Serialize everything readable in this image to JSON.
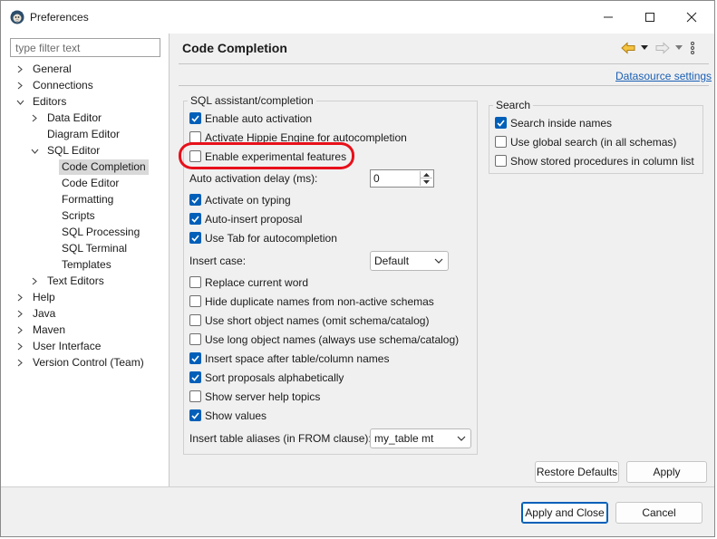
{
  "window": {
    "title": "Preferences"
  },
  "filter": {
    "placeholder": "type filter text",
    "value": ""
  },
  "tree": [
    {
      "label": "General",
      "expanded": false
    },
    {
      "label": "Connections",
      "expanded": false
    },
    {
      "label": "Editors",
      "expanded": true
    },
    {
      "label": "Data Editor",
      "expanded": false
    },
    {
      "label": "Diagram Editor"
    },
    {
      "label": "SQL Editor",
      "expanded": true
    },
    {
      "label": "Code Completion",
      "selected": true
    },
    {
      "label": "Code Editor"
    },
    {
      "label": "Formatting"
    },
    {
      "label": "Scripts"
    },
    {
      "label": "SQL Processing"
    },
    {
      "label": "SQL Terminal"
    },
    {
      "label": "Templates"
    },
    {
      "label": "Text Editors",
      "expanded": false
    },
    {
      "label": "Help",
      "expanded": false
    },
    {
      "label": "Java",
      "expanded": false
    },
    {
      "label": "Maven",
      "expanded": false
    },
    {
      "label": "User Interface",
      "expanded": false
    },
    {
      "label": "Version Control (Team)",
      "expanded": false
    }
  ],
  "page": {
    "title": "Code Completion",
    "datasource_link": "Datasource settings"
  },
  "sql_group": {
    "legend": "SQL assistant/completion",
    "enable_auto_activation": {
      "label": "Enable auto activation",
      "checked": true
    },
    "hippie_engine": {
      "label": "Activate Hippie Engine for autocompletion",
      "checked": false
    },
    "experimental": {
      "label": "Enable experimental features",
      "checked": false
    },
    "delay_label": "Auto activation delay (ms):",
    "delay_value": "0",
    "activate_on_typing": {
      "label": "Activate on typing",
      "checked": true
    },
    "auto_insert": {
      "label": "Auto-insert proposal",
      "checked": true
    },
    "use_tab": {
      "label": "Use Tab for autocompletion",
      "checked": true
    },
    "insert_case_label": "Insert case:",
    "insert_case_value": "Default",
    "replace_word": {
      "label": "Replace current word",
      "checked": false
    },
    "hide_duplicates": {
      "label": "Hide duplicate names from non-active schemas",
      "checked": false
    },
    "short_names": {
      "label": "Use short object names (omit schema/catalog)",
      "checked": false
    },
    "long_names": {
      "label": "Use long object names (always use schema/catalog)",
      "checked": false
    },
    "insert_space": {
      "label": "Insert space after table/column names",
      "checked": true
    },
    "sort_alpha": {
      "label": "Sort proposals alphabetically",
      "checked": true
    },
    "server_help": {
      "label": "Show server help topics",
      "checked": false
    },
    "show_values": {
      "label": "Show values",
      "checked": true
    },
    "aliases_label": "Insert table aliases (in FROM clause):",
    "aliases_value": "my_table mt"
  },
  "search_group": {
    "legend": "Search",
    "inside_names": {
      "label": "Search inside names",
      "checked": true
    },
    "global_search": {
      "label": "Use global search (in all schemas)",
      "checked": false
    },
    "stored_procs": {
      "label": "Show stored procedures in column list",
      "checked": false
    }
  },
  "buttons": {
    "restore_defaults": "Restore Defaults",
    "apply": "Apply",
    "apply_close": "Apply and Close",
    "cancel": "Cancel"
  },
  "colors": {
    "accent": "#005fb8",
    "highlight": "#e8101a",
    "link": "#1a5fb4"
  }
}
